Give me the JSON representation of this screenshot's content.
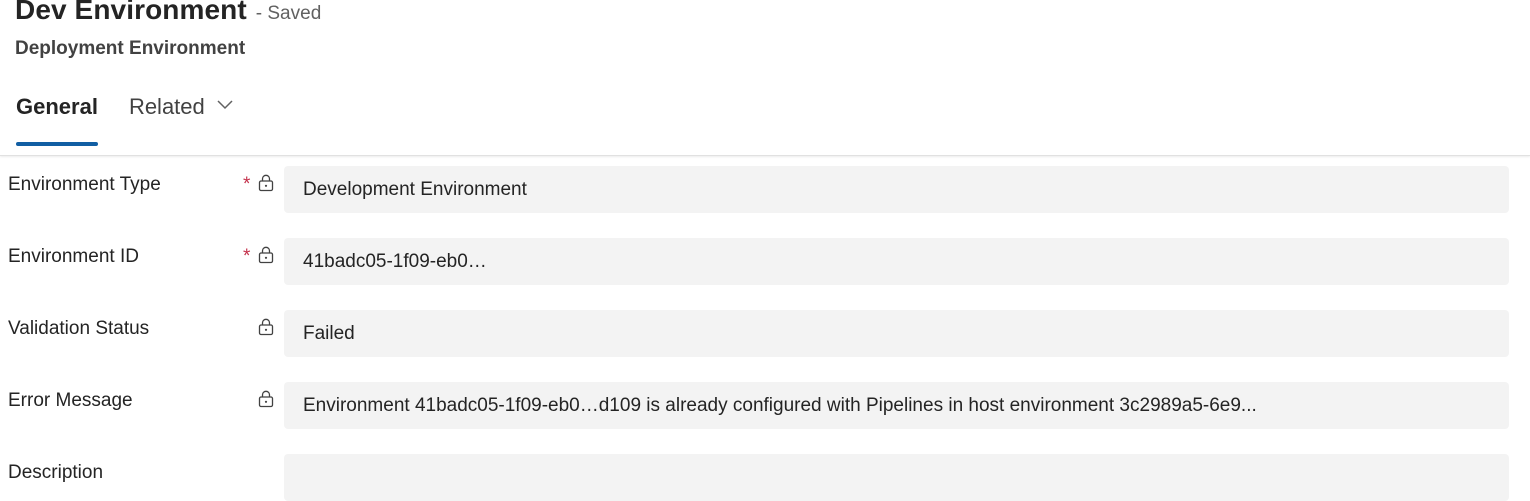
{
  "header": {
    "title": "Dev Environment",
    "saved_status": "- Saved",
    "subtitle": "Deployment Environment"
  },
  "tabs": [
    {
      "label": "General",
      "selected": true
    },
    {
      "label": "Related",
      "selected": false,
      "icon": "chevron-down-icon"
    }
  ],
  "colors": {
    "accent": "#115ea3",
    "required": "#c4314b",
    "field_bg": "#f3f3f3"
  },
  "fields": {
    "environment_type": {
      "label": "Environment Type",
      "required_mark": "*",
      "value": "Development Environment",
      "locked": true
    },
    "environment_id": {
      "label": "Environment ID",
      "required_mark": "*",
      "value": "41badc05-1f09-eb0…",
      "locked": true
    },
    "validation_status": {
      "label": "Validation Status",
      "value": "Failed",
      "locked": true
    },
    "error_message": {
      "label": "Error Message",
      "value": "Environment 41badc05-1f09-eb0…d109 is already configured with Pipelines in host environment 3c2989a5-6e9...",
      "locked": true
    },
    "description": {
      "label": "Description",
      "value": ""
    }
  }
}
